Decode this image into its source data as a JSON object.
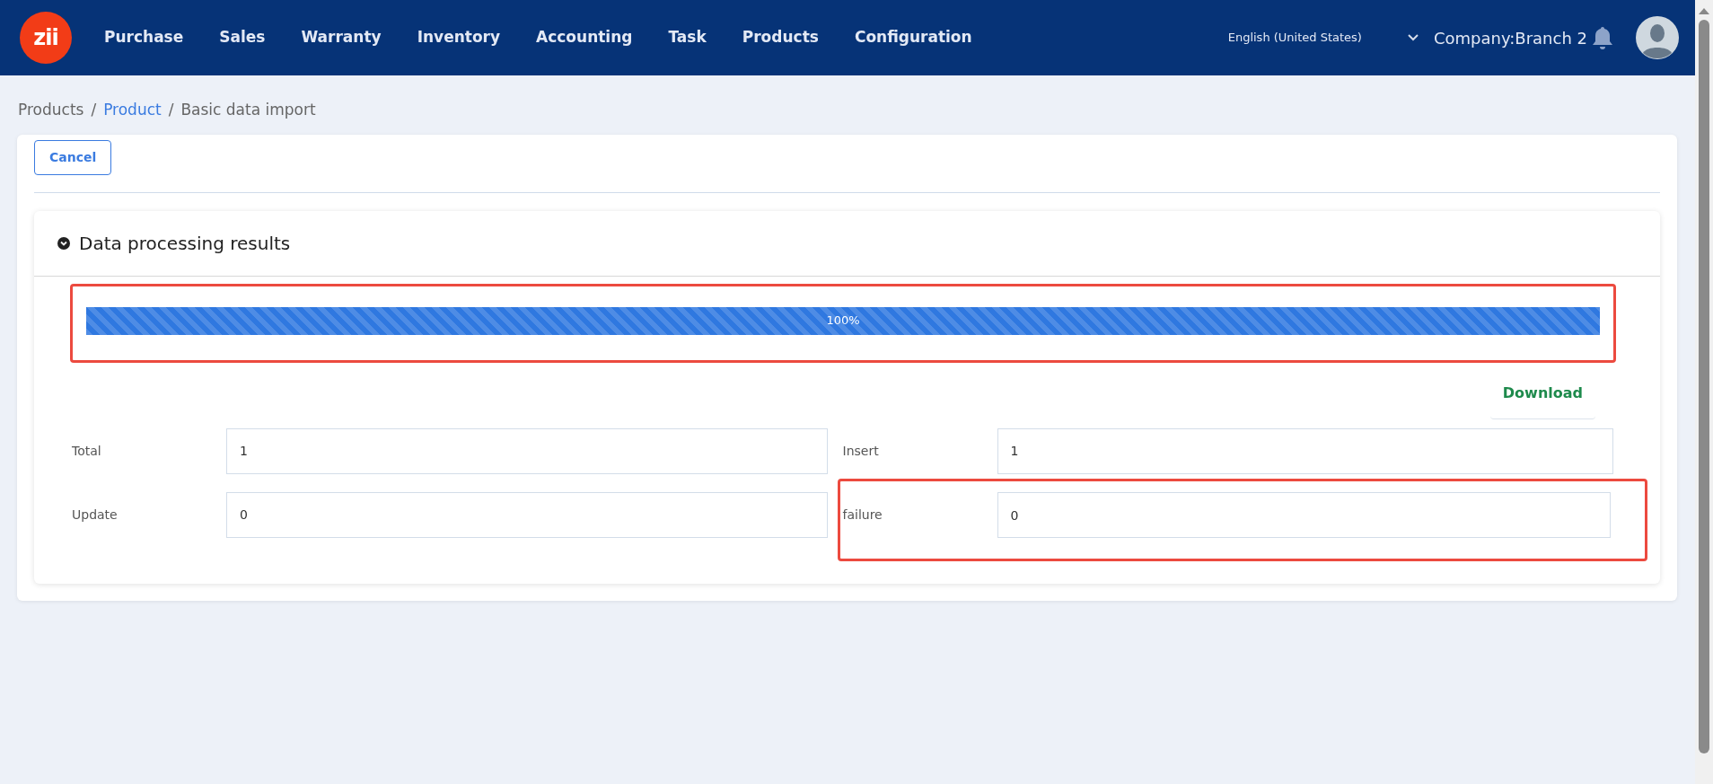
{
  "navbar": {
    "logo": "zii",
    "menu": [
      {
        "label": "Purchase"
      },
      {
        "label": "Sales"
      },
      {
        "label": "Warranty"
      },
      {
        "label": "Inventory"
      },
      {
        "label": "Accounting"
      },
      {
        "label": "Task"
      },
      {
        "label": "Products"
      },
      {
        "label": "Configuration"
      }
    ],
    "language": "English (United States)",
    "company": "Company:Branch 2"
  },
  "breadcrumb": {
    "separator": "/",
    "items": [
      {
        "label": "Products",
        "link": false
      },
      {
        "label": "Product",
        "link": true
      },
      {
        "label": "Basic data import",
        "link": false
      }
    ]
  },
  "toolbar": {
    "cancel": "Cancel"
  },
  "results": {
    "title": "Data processing results",
    "expanded": true,
    "progress": {
      "level": 1,
      "reading": "100%",
      "highlighted": true
    },
    "download": "Download",
    "fields": [
      {
        "label": "Total",
        "value": "1",
        "highlighted": false
      },
      {
        "label": "Insert",
        "value": "1",
        "highlighted": false
      },
      {
        "label": "Update",
        "value": "0",
        "highlighted": false
      },
      {
        "label": "failure",
        "value": "0",
        "highlighted": true
      }
    ]
  }
}
